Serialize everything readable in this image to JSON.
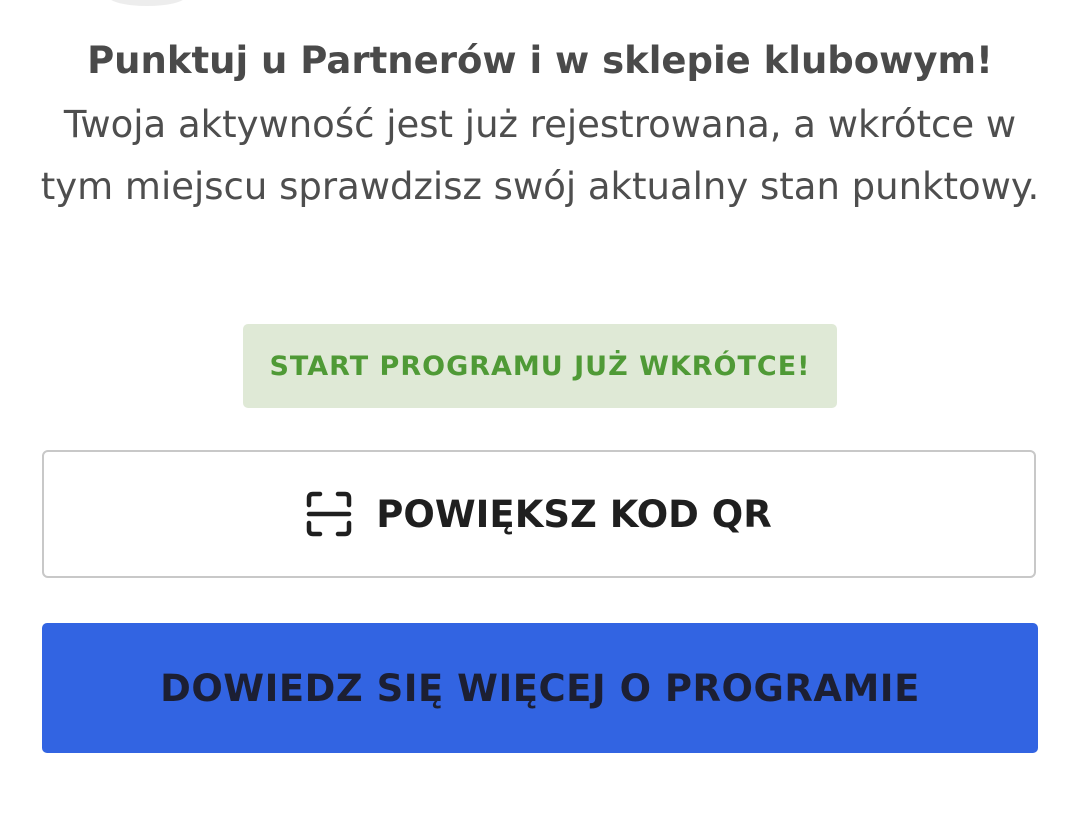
{
  "loyalty": {
    "headline": "Punktuj u Partnerów i w sklepie klubowym!",
    "description": "Twoja aktywność jest już rejestrowana, a wkrótce w tym miejscu sprawdzisz swój aktualny stan punktowy.",
    "notice_badge": "START PROGRAMU JUŻ WKRÓTCE!"
  },
  "actions": {
    "qr_button_label": "POWIĘKSZ KOD QR",
    "qr_button_icon": "scan-icon",
    "info_button_label": "DOWIEDZ SIĘ WIĘCEJ O PROGRAMIE"
  },
  "colors": {
    "accent_blue": "#3264e2",
    "badge_background": "#dfe9d6",
    "badge_text": "#4f9a36",
    "text_dark": "#4a4a4a"
  }
}
